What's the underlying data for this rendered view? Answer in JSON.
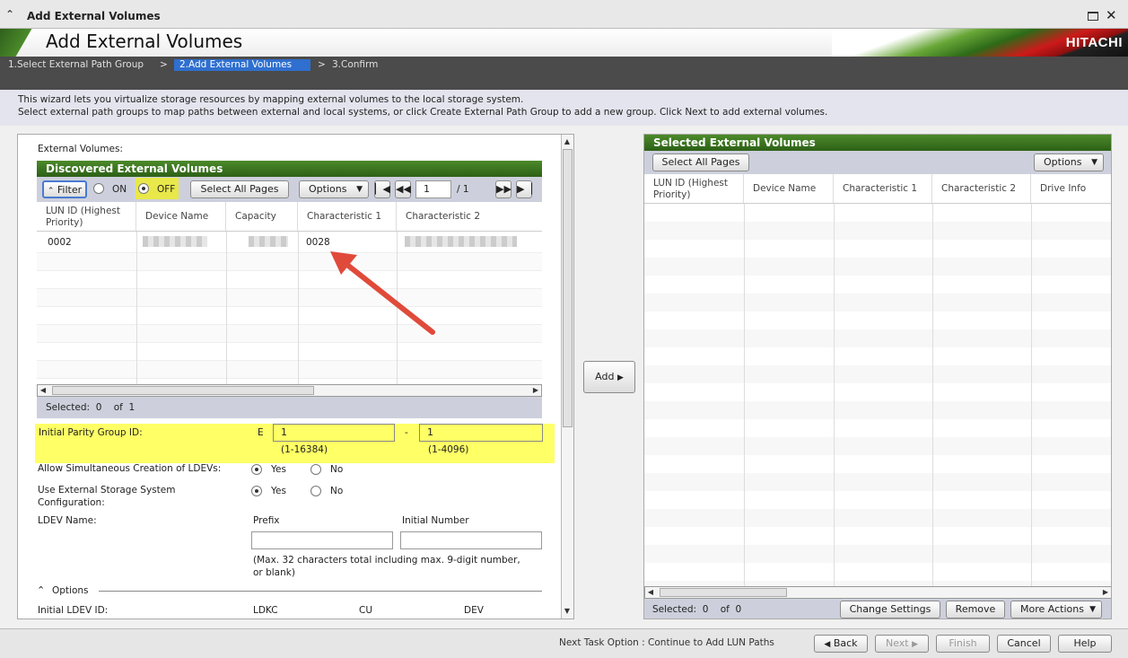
{
  "window": {
    "title": "Add External Volumes"
  },
  "banner": {
    "title": "Add External Volumes",
    "logo": "HITACHI"
  },
  "steps": [
    {
      "label": "1.Select External Path Group"
    },
    {
      "label": ">"
    },
    {
      "label": "2.Add External Volumes",
      "active": true
    },
    {
      "label": ">"
    },
    {
      "label": "3.Confirm"
    }
  ],
  "intro": {
    "line1": "This wizard lets you virtualize storage resources by mapping external volumes to the local storage system.",
    "line2": "Select external path groups to map paths between external and local systems, or click Create External Path Group to add a new group. Click Next to add external volumes."
  },
  "left": {
    "section_label": "External Volumes:",
    "table_title": "Discovered External Volumes",
    "filter_label": "Filter",
    "on_label": "ON",
    "off_label": "OFF",
    "select_all_label": "Select All Pages",
    "options_label": "Options",
    "page_current": "1",
    "page_total": "/ 1",
    "columns": [
      "LUN ID (Highest Priority)",
      "Device Name",
      "Capacity",
      "Characteristic 1",
      "Characteristic 2"
    ],
    "rows": [
      {
        "lun": "0002",
        "char1": "0028"
      }
    ],
    "selected_text": "Selected:  0    of  1",
    "parity_label": "Initial Parity Group ID:",
    "parity_prefix": "E",
    "parity_val1": "1",
    "parity_range1": "(1-16384)",
    "parity_dash": "-",
    "parity_val2": "1",
    "parity_range2": "(1-4096)",
    "allow_label": "Allow Simultaneous Creation of LDEVs:",
    "use_ext_label1": "Use External Storage System",
    "use_ext_label2": "Configuration:",
    "yes_label": "Yes",
    "no_label": "No",
    "ldev_name_label": "LDEV Name:",
    "prefix_label": "Prefix",
    "initial_number_label": "Initial Number",
    "max_note1": "(Max. 32 characters total including max. 9-digit number,",
    "max_note2": "or blank)",
    "options_section": "Options",
    "initial_ldev_label": "Initial LDEV ID:",
    "ldkc_label": "LDKC",
    "cu_label": "CU",
    "dev_label": "DEV"
  },
  "add_button": "Add",
  "right": {
    "table_title": "Selected External Volumes",
    "select_all_label": "Select All Pages",
    "options_label": "Options",
    "columns": [
      "LUN ID (Highest Priority)",
      "Device Name",
      "Characteristic 1",
      "Characteristic 2",
      "Drive Info"
    ],
    "selected_text": "Selected:  0    of  0",
    "change_settings": "Change Settings",
    "remove": "Remove",
    "more_actions": "More Actions"
  },
  "footer": {
    "next_task": "Next Task Option : Continue to Add LUN Paths",
    "back": "Back",
    "next": "Next",
    "finish": "Finish",
    "cancel": "Cancel",
    "help": "Help"
  },
  "colors": {
    "green_header": "#2d6017",
    "active_step": "#2f6fcf",
    "highlight": "#ffff66",
    "arrow": "#e04a3a"
  }
}
